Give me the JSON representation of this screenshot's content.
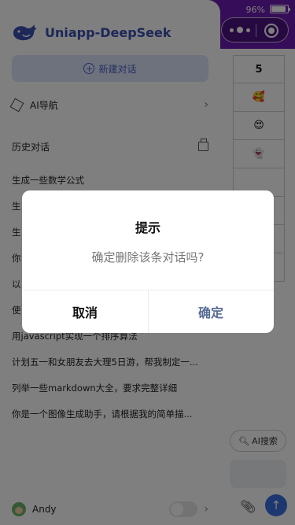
{
  "status": {
    "battery": "96%"
  },
  "background": {
    "table_cells": [
      "5",
      "🥰",
      "😍",
      "👻"
    ],
    "search_label": "AI搜索",
    "attach_icon": "paperclip-icon",
    "send_icon": "arrow-up-icon"
  },
  "sidebar": {
    "app_name": "Uniapp-DeepSeek",
    "new_chat_label": "新建对话",
    "nav_label": "AI导航",
    "history_title": "历史对话",
    "history": [
      "生成一些数学公式",
      "生",
      "生",
      "你",
      "以",
      "使",
      "用javascript实现一个排序算法",
      "计划五一和女朋友去大理5日游，帮我制定一...",
      "列举一些markdown大全，要求完整详细",
      "你是一个图像生成助手，请根据我的简单描..."
    ],
    "user_name": "Andy"
  },
  "dialog": {
    "title": "提示",
    "message": "确定删除该条对话吗?",
    "cancel_label": "取消",
    "confirm_label": "确定"
  },
  "colors": {
    "header": "#6a1ab0",
    "brand": "#3a4fb0",
    "confirm": "#576b95"
  }
}
